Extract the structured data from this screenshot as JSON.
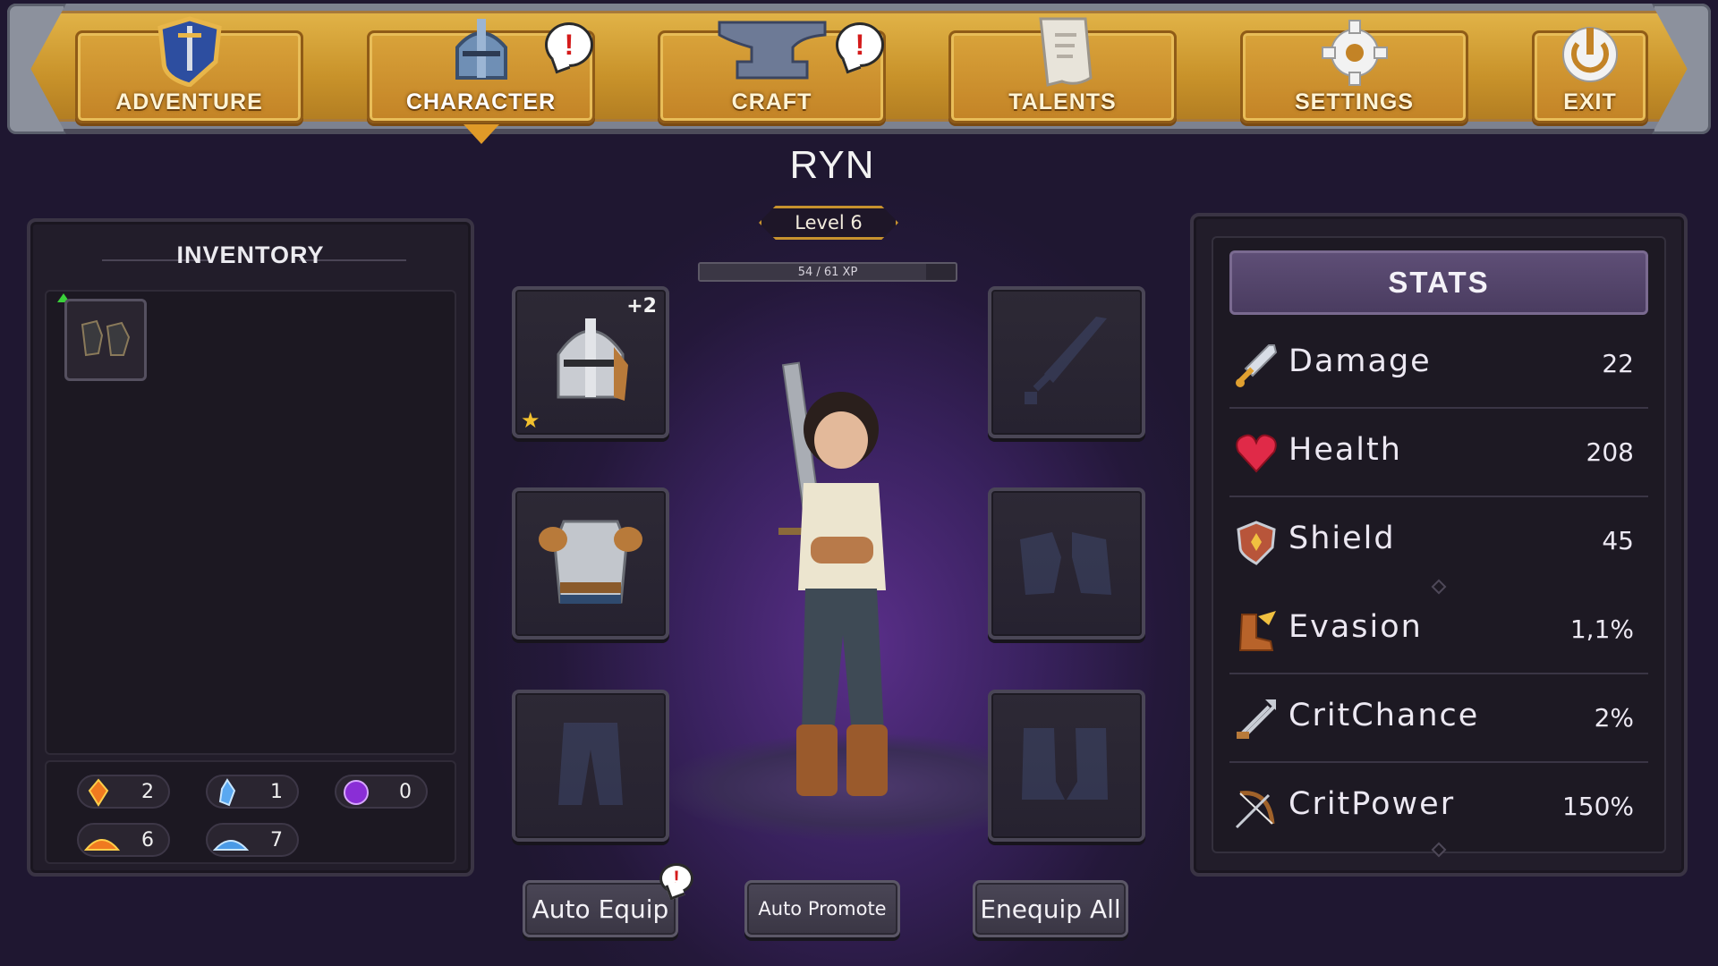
{
  "nav": {
    "items": [
      {
        "label": "ADVENTURE",
        "icon": "shield-sword-icon",
        "alert": false,
        "active": false
      },
      {
        "label": "CHARACTER",
        "icon": "helmet-icon",
        "alert": true,
        "active": true
      },
      {
        "label": "CRAFT",
        "icon": "anvil-icon",
        "alert": true,
        "active": false
      },
      {
        "label": "TALENTS",
        "icon": "scroll-icon",
        "alert": false,
        "active": false
      },
      {
        "label": "SETTINGS",
        "icon": "gear-icon",
        "alert": false,
        "active": false
      },
      {
        "label": "EXIT",
        "icon": "power-icon",
        "alert": false,
        "active": false
      }
    ],
    "alert_symbol": "!"
  },
  "character": {
    "name": "RYN",
    "level_label": "Level 6",
    "xp_text": "54 / 61 XP",
    "xp_progress": 0.885
  },
  "inventory": {
    "title": "INVENTORY",
    "items": [
      {
        "icon": "gauntlets-icon",
        "upgrade": true
      }
    ],
    "resources": [
      {
        "icon": "fire-crystal-icon",
        "count": "2"
      },
      {
        "icon": "ice-crystal-icon",
        "count": "1"
      },
      {
        "icon": "purple-orb-icon",
        "count": "0"
      },
      {
        "icon": "fire-dust-icon",
        "count": "6"
      },
      {
        "icon": "ice-dust-icon",
        "count": "7"
      }
    ]
  },
  "equipment": {
    "helmet": {
      "icon": "helmet-icon",
      "upgrade_label": "+2",
      "starred": true,
      "star_symbol": "★"
    },
    "armor": {
      "icon": "chest-armor-icon"
    },
    "pants": {
      "icon": "pants-icon",
      "empty": true
    },
    "weapon": {
      "icon": "sword-icon",
      "empty": true
    },
    "gloves": {
      "icon": "gloves-icon",
      "empty": true
    },
    "boots": {
      "icon": "boots-icon",
      "empty": true
    }
  },
  "stats": {
    "title": "STATS",
    "rows": [
      {
        "name": "Damage",
        "value": "22",
        "icon": "sword-icon"
      },
      {
        "name": "Health",
        "value": "208",
        "icon": "heart-icon"
      },
      {
        "name": "Shield",
        "value": "45",
        "icon": "shield-icon"
      },
      {
        "name": "Evasion",
        "value": "1,1%",
        "icon": "winged-boot-icon"
      },
      {
        "name": "CritChance",
        "value": "2%",
        "icon": "arrows-icon"
      },
      {
        "name": "CritPower",
        "value": "150%",
        "icon": "bow-icon"
      }
    ]
  },
  "actions": {
    "auto_equip": "Auto Equip",
    "auto_equip_alert": "!",
    "auto_promote": "Auto Promote",
    "unequip_all": "Enequip All"
  },
  "colors": {
    "gold": "#d9a33a",
    "alert_red": "#d41b1b",
    "background": "#24183a",
    "star": "#f2c12e"
  }
}
